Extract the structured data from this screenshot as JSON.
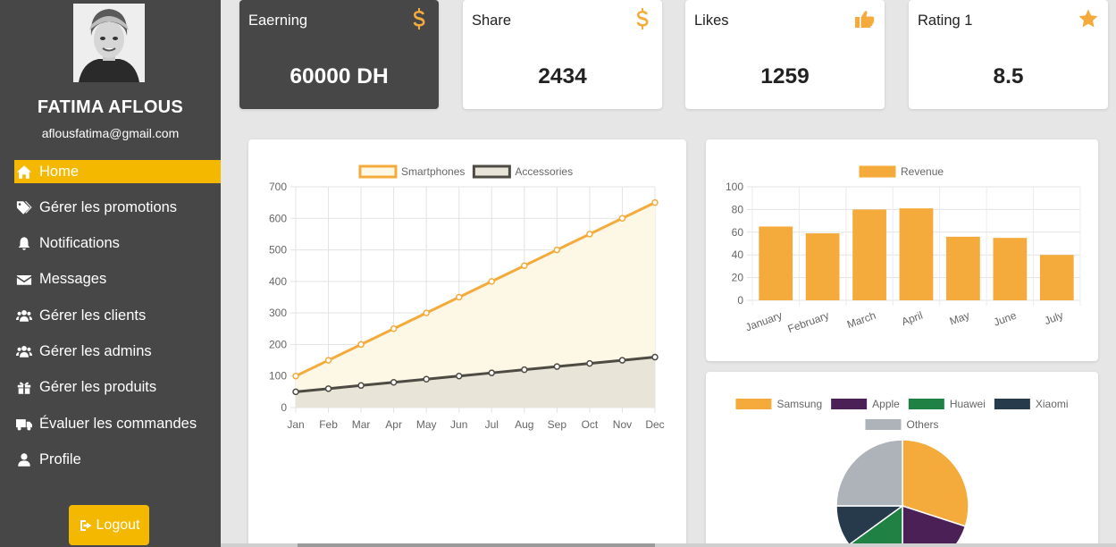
{
  "user": {
    "name": "FATIMA AFLOUS",
    "email": "aflousfatima@gmail.com"
  },
  "sidebar": {
    "items": [
      {
        "label": "Home",
        "icon": "home-icon",
        "active": true
      },
      {
        "label": "Gérer les promotions",
        "icon": "tags-icon"
      },
      {
        "label": "Notifications",
        "icon": "bell-icon"
      },
      {
        "label": "Messages",
        "icon": "envelope-icon"
      },
      {
        "label": "Gérer les clients",
        "icon": "users-icon"
      },
      {
        "label": "Gérer les admins",
        "icon": "users-icon"
      },
      {
        "label": "Gérer les produits",
        "icon": "gift-icon"
      },
      {
        "label": "Évaluer les commandes",
        "icon": "truck-icon"
      },
      {
        "label": "Profile",
        "icon": "user-icon"
      }
    ],
    "logout_label": "Logout"
  },
  "stats": [
    {
      "label": "Eaerning",
      "value": "60000 DH",
      "icon": "dollar-icon"
    },
    {
      "label": "Share",
      "value": "2434",
      "icon": "dollar-icon"
    },
    {
      "label": "Likes",
      "value": "1259",
      "icon": "thumbs-up-icon"
    },
    {
      "label": "Rating 1",
      "value": "8.5",
      "icon": "star-icon"
    }
  ],
  "colors": {
    "accent": "#f5b800",
    "sidebar": "#474747",
    "orange": "#f4ab3b",
    "dark_series": "#4e4b44",
    "apple": "#4a2057",
    "huawei": "#1f8143",
    "xiaomi": "#273a4c",
    "others": "#aeb2b9"
  },
  "chart_data": [
    {
      "type": "line",
      "categories": [
        "Jan",
        "Feb",
        "Mar",
        "Apr",
        "May",
        "Jun",
        "Jul",
        "Aug",
        "Sep",
        "Oct",
        "Nov",
        "Dec"
      ],
      "series": [
        {
          "name": "Smartphones",
          "values": [
            100,
            150,
            200,
            250,
            300,
            350,
            400,
            450,
            500,
            550,
            600,
            650
          ],
          "color": "#f4ab3b",
          "fill": "#fdf8e6"
        },
        {
          "name": "Accessories",
          "values": [
            50,
            60,
            70,
            80,
            90,
            100,
            110,
            120,
            130,
            140,
            150,
            160
          ],
          "color": "#4e4b44",
          "fill": "#e8e5d8"
        }
      ],
      "yticks": [
        "0",
        "100",
        "200",
        "300",
        "400",
        "500",
        "600",
        "700"
      ],
      "ylim": [
        0,
        700
      ],
      "legend": "top",
      "grid": true
    },
    {
      "type": "bar",
      "categories": [
        "January",
        "February",
        "March",
        "April",
        "May",
        "June",
        "July"
      ],
      "series": [
        {
          "name": "Revenue",
          "values": [
            65,
            59,
            80,
            81,
            56,
            55,
            40
          ],
          "color": "#f4ab3b"
        }
      ],
      "yticks": [
        "0",
        "20",
        "40",
        "60",
        "80",
        "100"
      ],
      "ylim": [
        0,
        100
      ],
      "legend": "top",
      "grid": true
    },
    {
      "type": "pie",
      "labels": [
        "Samsung",
        "Apple",
        "Huawei",
        "Xiaomi",
        "Others"
      ],
      "values": [
        30,
        20,
        15,
        10,
        25
      ],
      "colors": [
        "#f4ab3b",
        "#4a2057",
        "#1f8143",
        "#273a4c",
        "#aeb2b9"
      ],
      "legend": "top"
    }
  ]
}
